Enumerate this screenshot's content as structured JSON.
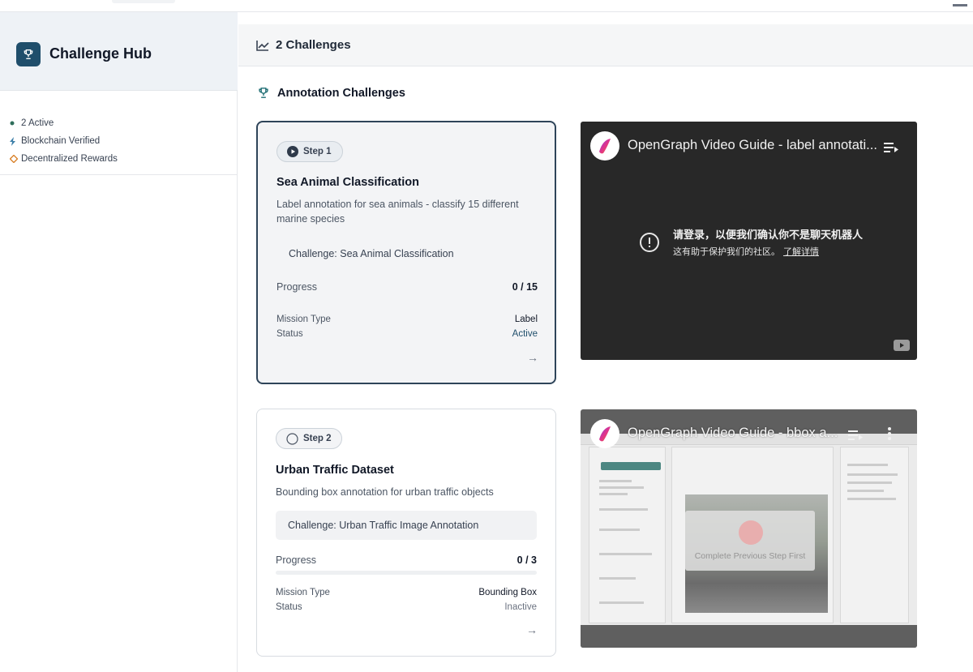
{
  "sidebar": {
    "brand_title": "Challenge Hub",
    "stats": [
      {
        "label": "2 Active",
        "icon": "dot-icon",
        "color": "#2f6e5b"
      },
      {
        "label": "Blockchain Verified",
        "icon": "bolt-icon",
        "color": "#3d7fa8"
      },
      {
        "label": "Decentralized Rewards",
        "icon": "diamond-icon",
        "color": "#d9822b"
      }
    ]
  },
  "header": {
    "title": "2 Challenges",
    "icon": "trending-icon"
  },
  "section": {
    "title": "Annotation Challenges",
    "icon": "trophy-icon"
  },
  "challenges": [
    {
      "step": "Step 1",
      "title": "Sea Animal Classification",
      "description": "Label annotation for sea animals - classify 15 different marine species",
      "challenge": "Challenge: Sea Animal Classification",
      "progress_label": "Progress",
      "progress_value": "0 / 15",
      "progress_fraction": 0,
      "mission_type_label": "Mission Type",
      "mission_type": "Label",
      "status_label": "Status",
      "status": "Active",
      "video": {
        "title": "OpenGraph Video Guide - label annotati...",
        "message_line1": "请登录，以便我们确认你不是聊天机器人",
        "message_line2": "这有助于保护我们的社区。",
        "learn_more": "了解详情"
      }
    },
    {
      "step": "Step 2",
      "title": "Urban Traffic Dataset",
      "description": "Bounding box annotation for urban traffic objects",
      "challenge": "Challenge: Urban Traffic Image Annotation",
      "progress_label": "Progress",
      "progress_value": "0 / 3",
      "progress_fraction": 0,
      "mission_type_label": "Mission Type",
      "mission_type": "Bounding Box",
      "status_label": "Status",
      "status": "Inactive",
      "video": {
        "title": "OpenGraph Video Guide - bbox a...",
        "lock_text": "Complete Previous Step First"
      }
    }
  ],
  "colors": {
    "accent": "#2e4459",
    "brand": "#1f4e6b"
  }
}
